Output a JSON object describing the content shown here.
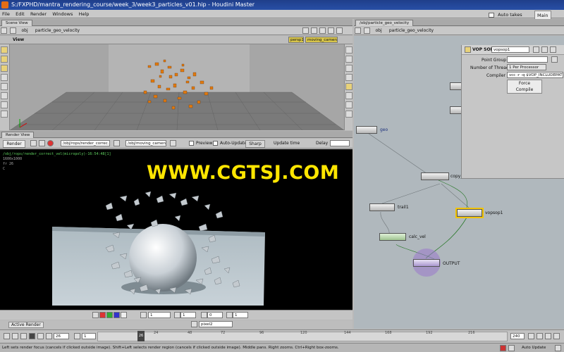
{
  "window": {
    "title": "S:/FXPHD/mantra_rendering_course/week_3/week3_particles_v01.hip - Houdini Master",
    "auto_takes_label": "Auto takes",
    "main_button": "Main"
  },
  "menu": [
    "File",
    "Edit",
    "Render",
    "Windows",
    "Help"
  ],
  "scene_view": {
    "tab": "Scene View",
    "path_root": "obj",
    "path_node": "particle_geo_velocity",
    "view_label": "View",
    "camera_left": "persp1",
    "camera_right": "moving_camera"
  },
  "render_view": {
    "tab": "Render View",
    "render_button": "Render",
    "rop_path": "/obj/rops/render_correc...",
    "camera_path": "/obj/moving_camera",
    "preview_label": "Preview",
    "auto_update_label": "Auto-Update",
    "sharp_label": "Sharp",
    "update_time_label": "Update time",
    "delay_label": "Delay",
    "info_line1": "/obj/rops/render_correct_vel(micropoly)-16:54:48[1]",
    "info_line2": "1600x1000",
    "info_line3": "fr 26",
    "info_line4": "C",
    "watermark": "WWW.CGTSJ.COM",
    "bottom_field1": "1",
    "bottom_field2": "1",
    "bottom_field3": "0",
    "bottom_field4": "1",
    "active_render_label": "Active Render",
    "pixel_field": "pixel2"
  },
  "network_view": {
    "tab": "/obj/particle_geo_velocity",
    "path_root": "obj",
    "path_node": "particle_geo_velocity",
    "nodes": {
      "geo": "geo",
      "copy": "copy_",
      "trail": "trail1",
      "vopsop": "vopsop1",
      "calc_vel": "calc_vel",
      "output": "OUTPUT"
    }
  },
  "params": {
    "node_type": "VOP SOP",
    "node_name": "vopsop1",
    "point_group_label": "Point Group",
    "threads_label": "Number of Threads",
    "threads_value": "1 Per Processor",
    "compiler_label": "Compiler",
    "compiler_value": "vcc -r -q $VOP_INCLUDEPATH",
    "force_compile": "Force Compile"
  },
  "timeline": {
    "frame_field": "26",
    "start_field": "1",
    "end_field": "240",
    "ticks": [
      "24",
      "48",
      "72",
      "96",
      "120",
      "144",
      "168",
      "192",
      "216"
    ],
    "current_frame": "26",
    "auto_update": "Auto Update"
  },
  "status": {
    "text": "Left sets render focus (cancels if clicked outside image). Shift+Left selects render region (cancels if clicked outside image). Middle pans. Right zooms. Ctrl+Right box-zooms."
  },
  "colors": {
    "title_bar": "#284fa6",
    "viewport_bg": "#a4a4a4",
    "particle": "#e07a10",
    "render_bg": "#000000",
    "watermark": "#ffe600",
    "vop_node_ring": "#f2c400",
    "output_node": "#9a79cc"
  }
}
